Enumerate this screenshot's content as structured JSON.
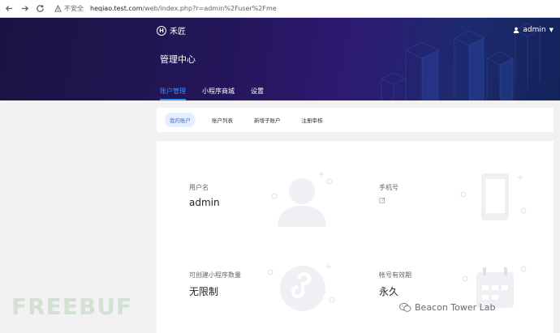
{
  "browser": {
    "insecure_label": "不安全",
    "url_host": "heqiao.test.com",
    "url_path": "/web/index.php?r=admin%2Fuser%2Fme"
  },
  "header": {
    "logo_text": "禾匠",
    "logo_mark": "H",
    "username": "admin",
    "title": "管理中心",
    "tabs": [
      {
        "label": "账户管理",
        "active": true
      },
      {
        "label": "小程序商城",
        "active": false
      },
      {
        "label": "设置",
        "active": false
      }
    ]
  },
  "subnav": {
    "tabs": [
      {
        "label": "我的账户",
        "active": true
      },
      {
        "label": "账户列表",
        "active": false
      },
      {
        "label": "新增子账户",
        "active": false
      },
      {
        "label": "注册审核",
        "active": false
      }
    ]
  },
  "info": {
    "username_label": "用户名",
    "username_value": "admin",
    "phone_label": "手机号",
    "miniapp_label": "可创建小程序数量",
    "miniapp_value": "无限制",
    "expiry_label": "帐号有效期",
    "expiry_value": "永久"
  },
  "watermarks": {
    "left": "FREEBUF",
    "right": "Beacon Tower Lab"
  },
  "colors": {
    "accent": "#3d8bff",
    "hero_dark": "#1a1442",
    "hero_purple": "#2d1a72"
  },
  "icons": [
    "back-arrow-icon",
    "forward-arrow-icon",
    "reload-icon",
    "warning-icon",
    "user-icon",
    "chevron-down-icon",
    "edit-icon",
    "wechat-icon"
  ]
}
